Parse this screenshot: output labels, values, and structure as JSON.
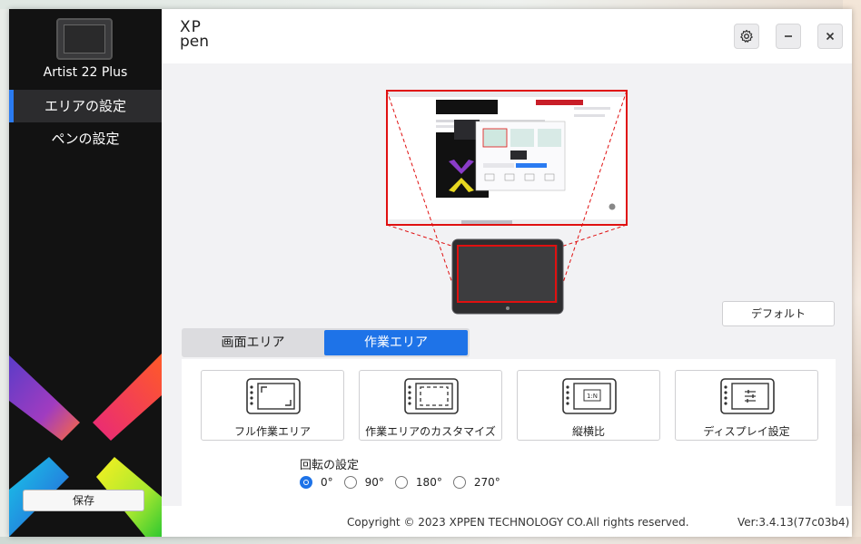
{
  "sidebar": {
    "device_name": "Artist 22 Plus",
    "items": [
      {
        "label": "エリアの設定",
        "active": true
      },
      {
        "label": "ペンの設定",
        "active": false
      }
    ],
    "save_label": "保存"
  },
  "header": {
    "brand_top": "XP",
    "brand_bottom": "pen",
    "settings_icon": "gear-icon",
    "minimize_icon": "minimize-icon",
    "close_icon": "close-icon"
  },
  "main": {
    "default_label": "デフォルト",
    "tabs": [
      {
        "label": "画面エリア",
        "active": false
      },
      {
        "label": "作業エリア",
        "active": true
      }
    ],
    "options": [
      {
        "label": "フル作業エリア",
        "icon": "full-area-icon"
      },
      {
        "label": "作業エリアのカスタマイズ",
        "icon": "custom-area-icon"
      },
      {
        "label": "縦横比",
        "icon": "aspect-ratio-icon",
        "badge": "1:N"
      },
      {
        "label": "ディスプレイ設定",
        "icon": "display-settings-icon"
      }
    ],
    "rotation": {
      "title": "回転の設定",
      "options": [
        "0°",
        "90°",
        "180°",
        "270°"
      ],
      "selected": "0°"
    }
  },
  "footer": {
    "copyright": "Copyright © 2023  XPPEN TECHNOLOGY CO.All rights reserved.",
    "version": "Ver:3.4.13(77c03b4)"
  },
  "colors": {
    "accent": "#1e73e8",
    "area_border": "#e01010",
    "sidebar_bg": "#121212"
  }
}
